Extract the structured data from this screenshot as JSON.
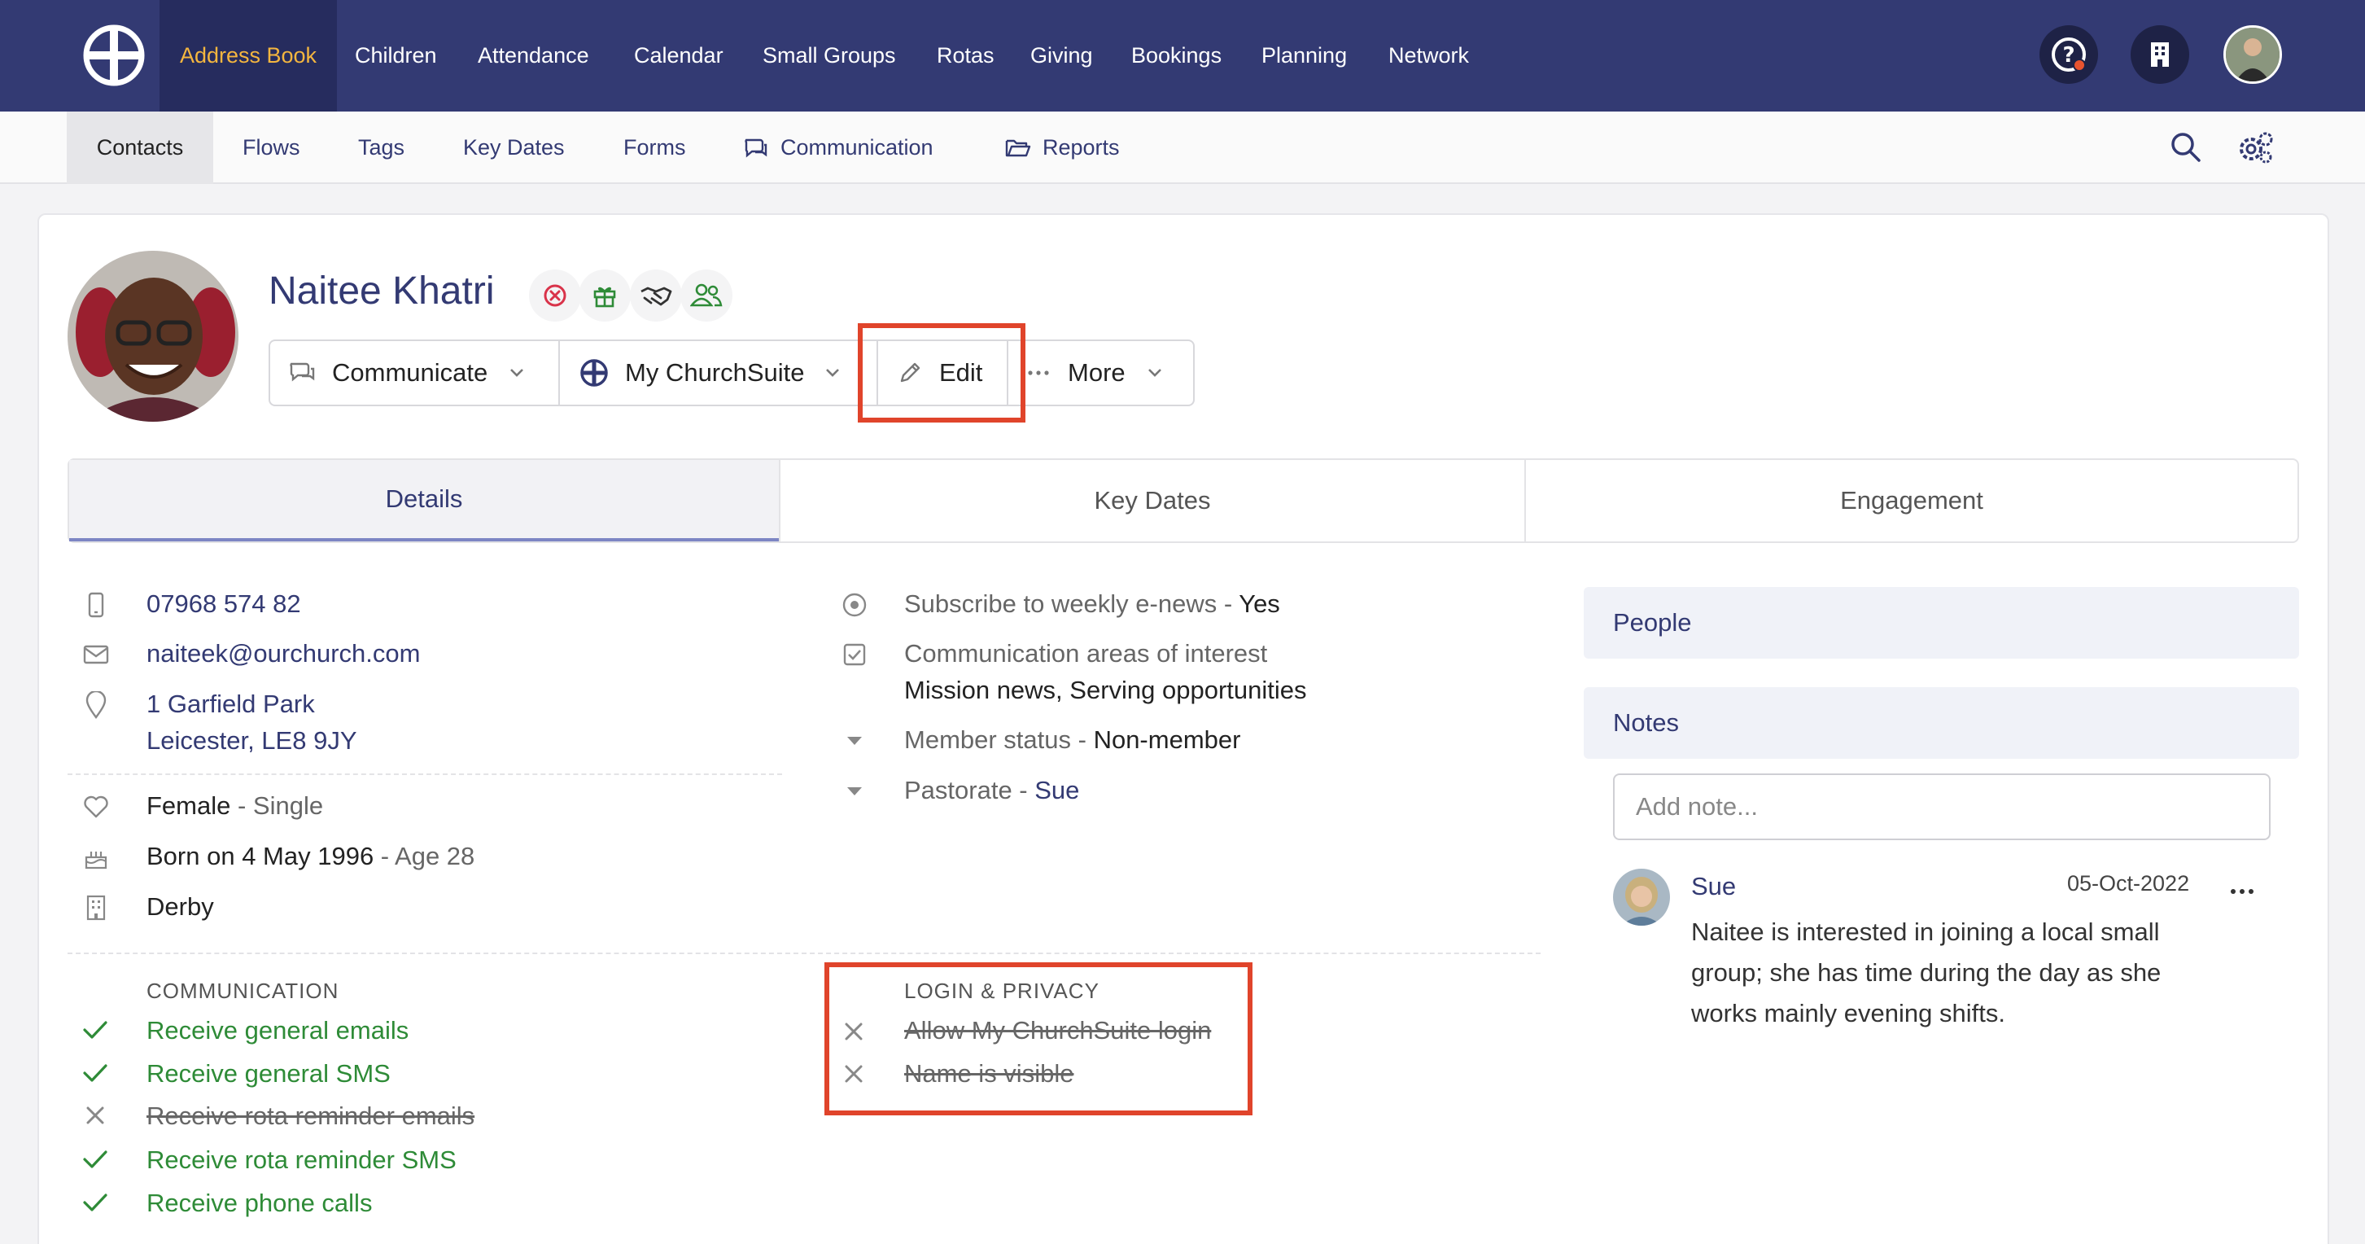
{
  "topnav": {
    "items": [
      "Address Book",
      "Children",
      "Attendance",
      "Calendar",
      "Small Groups",
      "Rotas",
      "Giving",
      "Bookings",
      "Planning",
      "Network"
    ],
    "active": "Address Book"
  },
  "subnav": {
    "items": [
      "Contacts",
      "Flows",
      "Tags",
      "Key Dates",
      "Forms",
      "Communication",
      "Reports"
    ],
    "active": "Contacts"
  },
  "contact": {
    "name": "Naitee Khatri"
  },
  "actions": {
    "communicate": "Communicate",
    "mychurchsuite": "My ChurchSuite",
    "edit": "Edit",
    "more": "More"
  },
  "tabs": [
    "Details",
    "Key Dates",
    "Engagement"
  ],
  "details": {
    "phone": "07968 574 82",
    "email": "naiteek@ourchurch.com",
    "address_line1": "1 Garfield Park",
    "address_line2": "Leicester, LE8 9JY",
    "sex": "Female",
    "marital": " - Single",
    "born": "Born on 4 May 1996",
    "age": " - Age 28",
    "site": "Derby"
  },
  "fields": {
    "enews_label": "Subscribe to weekly e-news - ",
    "enews_value": "Yes",
    "interest_label": "Communication areas of interest",
    "interest_value": "Mission news, Serving opportunities",
    "member_label": "Member status - ",
    "member_value": "Non-member",
    "pastorate_label": "Pastorate - ",
    "pastorate_value": "Sue"
  },
  "communication": {
    "heading": "COMMUNICATION",
    "items": [
      {
        "label": "Receive general emails",
        "enabled": true
      },
      {
        "label": "Receive general SMS",
        "enabled": true
      },
      {
        "label": "Receive rota reminder emails",
        "enabled": false
      },
      {
        "label": "Receive rota reminder SMS",
        "enabled": true
      },
      {
        "label": "Receive phone calls",
        "enabled": true
      }
    ]
  },
  "privacy": {
    "heading": "LOGIN & PRIVACY",
    "items": [
      {
        "label": "Allow My ChurchSuite login",
        "enabled": false
      },
      {
        "label": "Name is visible",
        "enabled": false
      }
    ]
  },
  "panel": {
    "people": "People",
    "notes": "Notes",
    "note_placeholder": "Add note...",
    "note": {
      "author": "Sue",
      "date": "05-Oct-2022",
      "text": "Naitee is interested in joining a local small group; she has time during the day as she works mainly evening shifts."
    }
  },
  "colors": {
    "nav_bg": "#333a73",
    "accent": "#f4b63f",
    "link": "#333a73",
    "success": "#2e8b37",
    "highlight": "#e0442b"
  }
}
